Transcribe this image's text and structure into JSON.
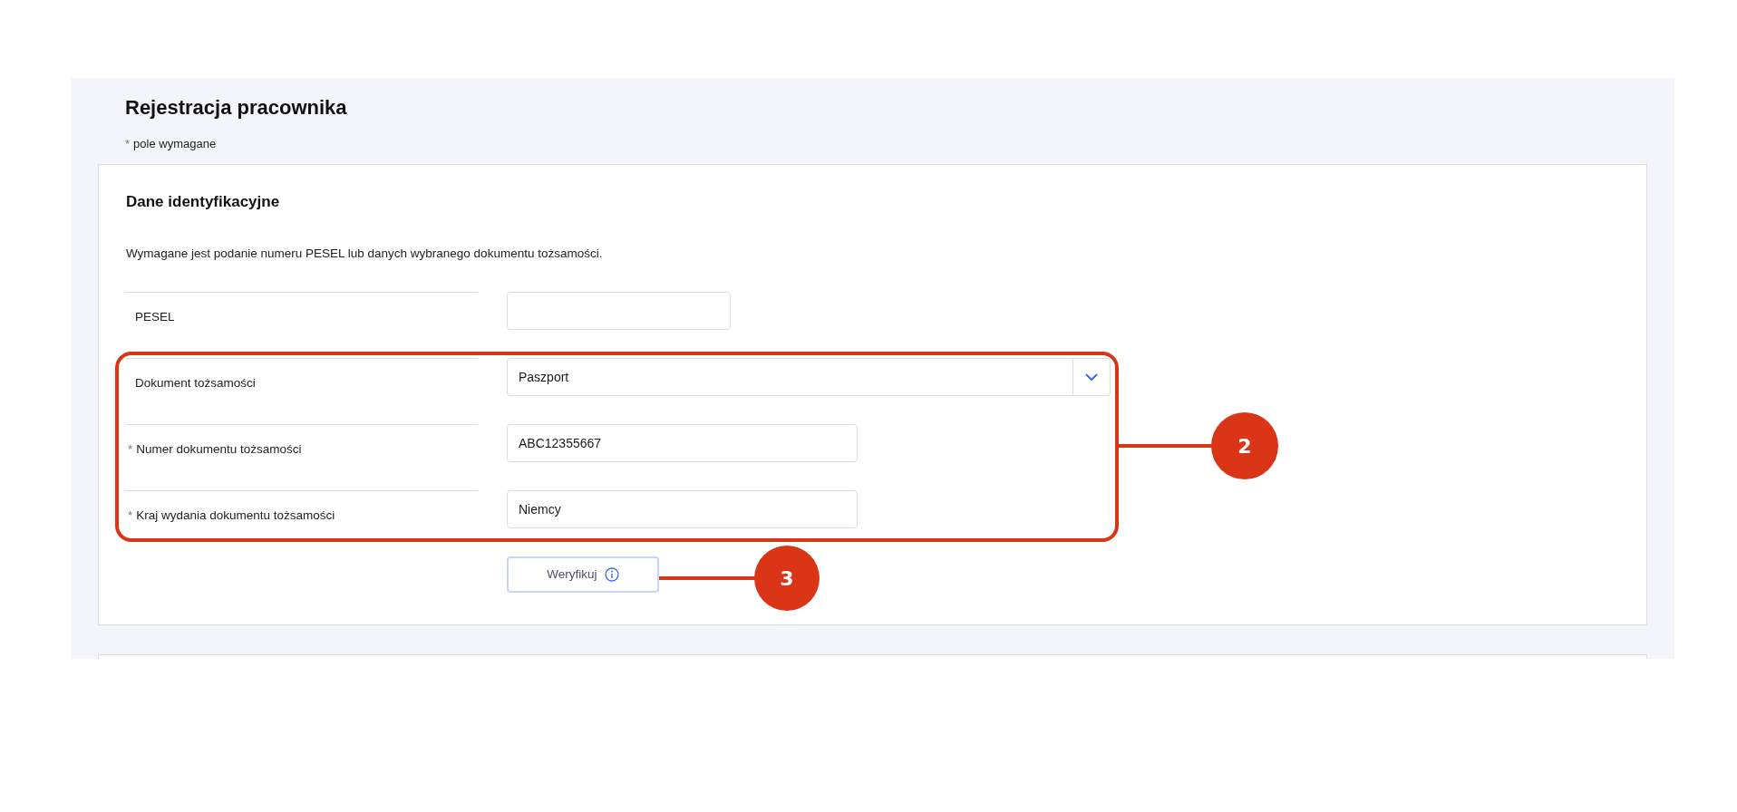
{
  "page": {
    "title": "Rejestracja pracownika",
    "required_note": {
      "mark": "*",
      "text": "pole wymagane"
    }
  },
  "section": {
    "title": "Dane identyfikacyjne",
    "info": "Wymagane jest podanie numeru PESEL lub danych wybranego dokumentu tożsamości.",
    "fields": [
      {
        "kind": "input",
        "label": "PESEL"
      },
      {
        "kind": "select",
        "label": "Dokument tożsamości",
        "value": "Paszport"
      },
      {
        "kind": "input",
        "label": "Numer dokumentu tożsamości",
        "mark": "*",
        "value": "ABC12355667"
      },
      {
        "kind": "input",
        "label": "Kraj wydania dokumentu tożsamości",
        "mark": "*",
        "value": "Niemcy"
      }
    ],
    "button": {
      "label": "Weryfikuj"
    }
  },
  "annotations": [
    {
      "number": "2"
    },
    {
      "number": "3"
    }
  ]
}
